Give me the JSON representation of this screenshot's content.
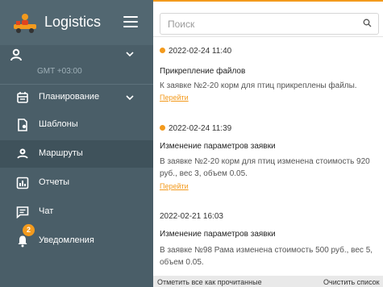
{
  "sidebar": {
    "app_title": "Logistics",
    "logo_icon": "delivery-person-icon",
    "menu_icon": "hamburger-icon",
    "user": {
      "timezone": "GMT +03:00",
      "icon": "person-icon"
    },
    "items": [
      {
        "label": "Планирование",
        "icon": "calendar-icon",
        "has_chevron": true
      },
      {
        "label": "Шаблоны",
        "icon": "document-pin-icon"
      },
      {
        "label": "Маршруты",
        "icon": "route-pin-icon",
        "active": true
      },
      {
        "label": "Отчеты",
        "icon": "bar-chart-icon"
      },
      {
        "label": "Чат",
        "icon": "chat-icon"
      },
      {
        "label": "Уведомления",
        "icon": "bell-icon",
        "badge": "2"
      }
    ]
  },
  "search": {
    "placeholder": "Поиск"
  },
  "notifications": [
    {
      "date": "2022-02-24 11:40",
      "unread": true,
      "title": "Прикрепление файлов",
      "body": "К заявке №2-20 корм для птиц прикреплены файлы.",
      "link": "Перейти"
    },
    {
      "date": "2022-02-24 11:39",
      "unread": true,
      "title": "Изменение параметров заявки",
      "body": "В заявке №2-20 корм для птиц изменена стоимость 920 руб., вес 3, объем 0.05.",
      "link": "Перейти"
    },
    {
      "date": "2022-02-21 16:03",
      "unread": false,
      "title": "Изменение параметров заявки",
      "body": "В заявке №98 Рама изменена стоимость 500 руб., вес 5, объем 0.05."
    }
  ],
  "footer": {
    "mark_all_read": "Отметить все как прочитанные",
    "clear_list": "Очистить список"
  },
  "colors": {
    "accent": "#f39a1d",
    "sidebar_bg": "#4a5e68",
    "sidebar_header_bg": "#526771",
    "active_item_bg": "#3f525b"
  }
}
